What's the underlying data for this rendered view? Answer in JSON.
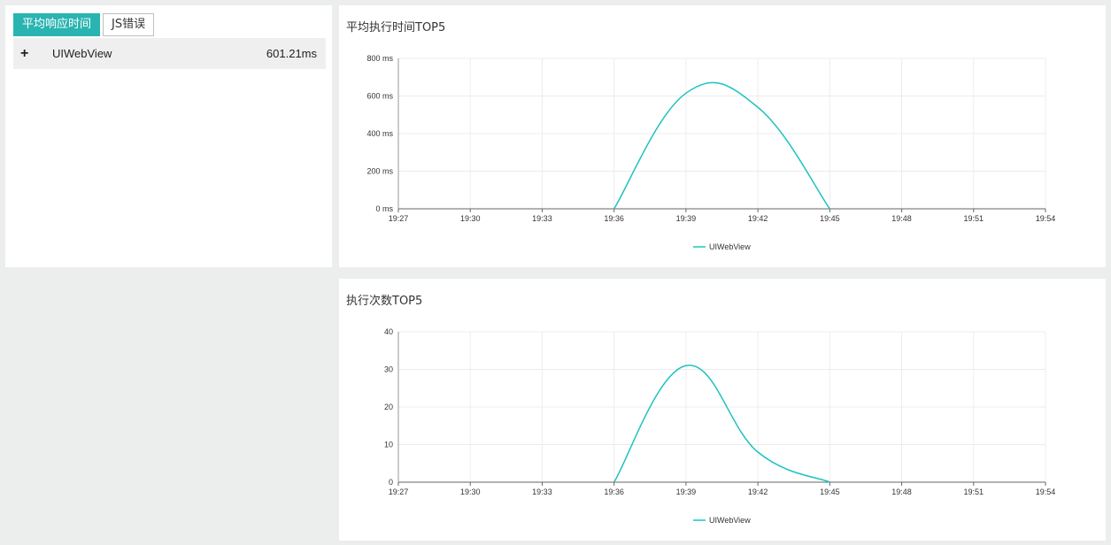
{
  "left": {
    "tabs": [
      {
        "label": "平均响应时间",
        "active": true
      },
      {
        "label": "JS错误",
        "active": false
      }
    ],
    "rows": [
      {
        "expand": "+",
        "name": "UIWebView",
        "value": "601.21ms"
      }
    ]
  },
  "charts": [
    {
      "title": "平均执行时间TOP5",
      "legend": "UIWebView",
      "color": "#1ec2c1"
    },
    {
      "title": "执行次数TOP5",
      "legend": "UIWebView",
      "color": "#1ec2c1"
    }
  ],
  "chart_data": [
    {
      "type": "line",
      "title": "平均执行时间TOP5",
      "x": [
        "19:27",
        "19:30",
        "19:33",
        "19:36",
        "19:39",
        "19:42",
        "19:45",
        "19:48",
        "19:51",
        "19:54"
      ],
      "y_ticks": [
        "0 ms",
        "200 ms",
        "400 ms",
        "600 ms",
        "800 ms"
      ],
      "ylim": [
        0,
        800
      ],
      "grid": true,
      "legend_position": "bottom",
      "series": [
        {
          "name": "UIWebView",
          "points": [
            [
              "19:36",
              0
            ],
            [
              "19:39",
              615
            ],
            [
              "19:42",
              540
            ],
            [
              "19:45",
              0
            ]
          ]
        }
      ]
    },
    {
      "type": "line",
      "title": "执行次数TOP5",
      "x": [
        "19:27",
        "19:30",
        "19:33",
        "19:36",
        "19:39",
        "19:42",
        "19:45",
        "19:48",
        "19:51",
        "19:54"
      ],
      "y_ticks": [
        "0",
        "10",
        "20",
        "30",
        "40"
      ],
      "ylim": [
        0,
        40
      ],
      "grid": true,
      "legend_position": "bottom",
      "series": [
        {
          "name": "UIWebView",
          "points": [
            [
              "19:36",
              0
            ],
            [
              "19:39",
              31
            ],
            [
              "19:42",
              8
            ],
            [
              "19:45",
              0
            ]
          ]
        }
      ]
    }
  ]
}
